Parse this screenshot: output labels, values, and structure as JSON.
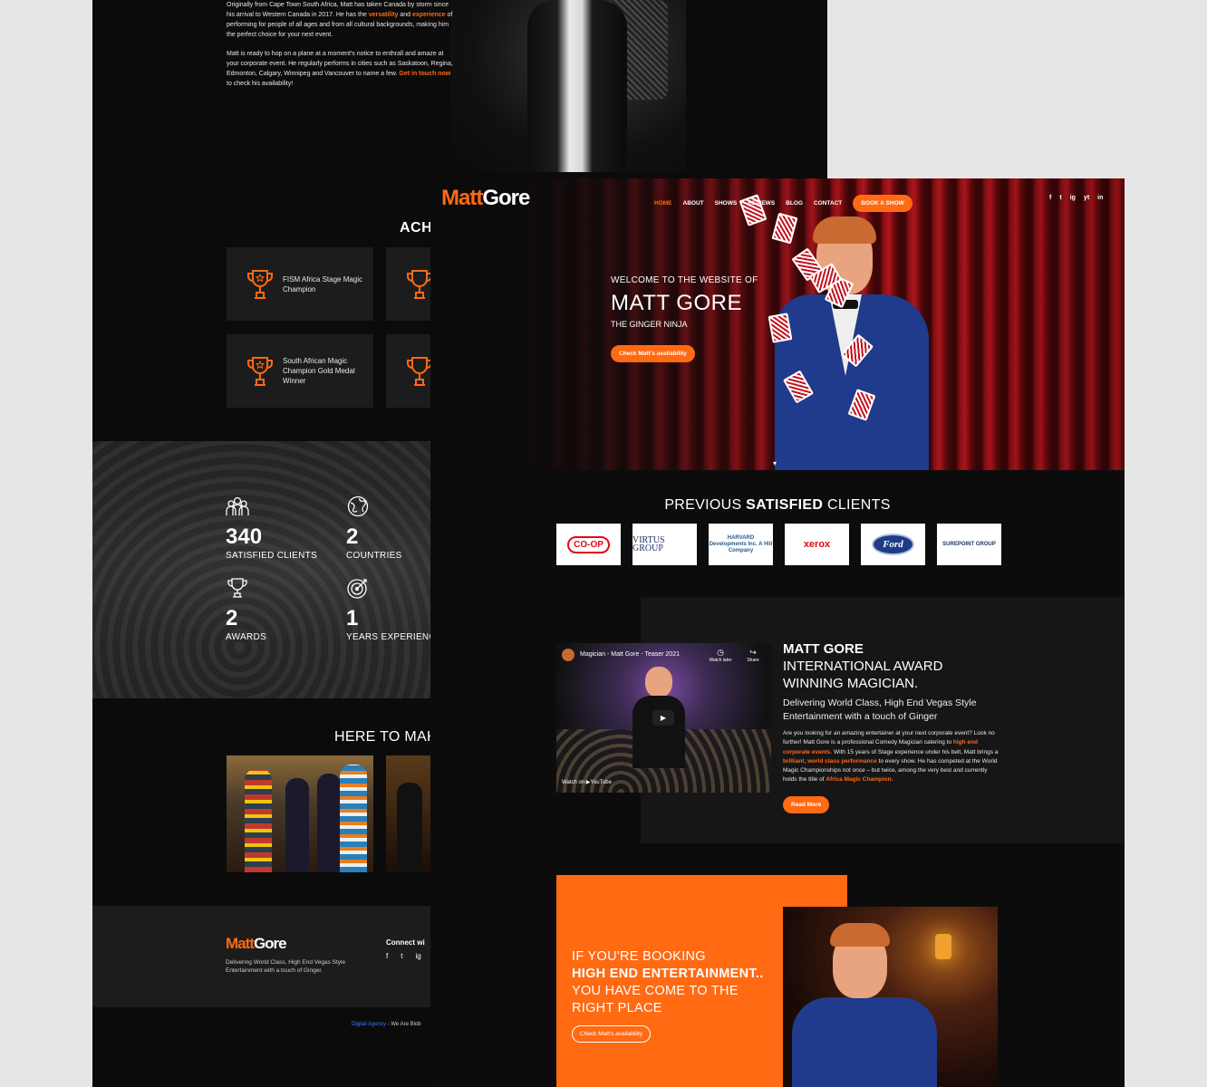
{
  "back": {
    "intro_p1_a": "Originally from Cape Town South Africa, Matt has taken Canada by storm since his arrival to Western Canada in 2017. He has the ",
    "intro_p1_hl1": "versatility",
    "intro_p1_b": " and ",
    "intro_p1_hl2": "experience",
    "intro_p1_c": " of performing for people of all ages and from all cultural backgrounds, making him the perfect choice for your next event.",
    "intro_p2_a": "Matt is ready to hop on a plane at a moment's notice to enthrall and amaze at your corporate event. He regularly performs in cities such as Saskatoon, Regina, Edmonton, Calgary, Winnipeg and Vancouver to name a few. ",
    "intro_p2_hl": "Get in touch now",
    "intro_p2_b": " to check his availability!",
    "achievements_title": "ACH",
    "achievements": [
      {
        "label": "FISM Africa Stage Magic Champion"
      },
      {
        "label": ""
      },
      {
        "label": "South African Magic Champion Gold Medal Winner"
      },
      {
        "label": ""
      }
    ],
    "stats": [
      {
        "num": "340",
        "label": "SATISFIED CLIENTS",
        "icon": "group-icon"
      },
      {
        "num": "2",
        "label": "COUNTRIES",
        "icon": "globe-icon"
      },
      {
        "num": "2",
        "label": "AWARDS",
        "icon": "trophy-icon"
      },
      {
        "num": "1",
        "label": "YEARS EXPERIENC",
        "icon": "target-icon"
      }
    ],
    "here_title": "HERE TO MAK",
    "footer": {
      "logo_a": "Matt",
      "logo_b": "Gore",
      "text": "Delivering World Class, High End Vegas Style Entertainment with a touch of Ginger.",
      "connect": "Connect wi",
      "socials": [
        "f",
        "t",
        "ig"
      ]
    },
    "credit_link": "Digital Agency",
    "credit_text": " - We Are Blob"
  },
  "front": {
    "logo_a": "Matt",
    "logo_b": "Gore",
    "nav": [
      "HOME",
      "ABOUT",
      "SHOWS",
      "REVIEWS",
      "BLOG",
      "CONTACT"
    ],
    "book_btn": "BOOK A SHOW",
    "socials": [
      "f",
      "t",
      "ig",
      "yt",
      "in"
    ],
    "hero": {
      "welcome": "WELCOME TO THE WEBSITE OF",
      "name": "MATT GORE",
      "tagline": "THE GINGER NINJA",
      "cta": "Check Matt's availability"
    },
    "clients_title_a": "PREVIOUS ",
    "clients_title_b": "SATISFIED",
    "clients_title_c": " CLIENTS",
    "clients": [
      "CO-OP",
      "VIRTUS GROUP",
      "HARVARD Developments Inc. A Hill Company",
      "xerox",
      "Ford",
      "SUREPOINT GROUP"
    ],
    "video": {
      "title": "Magician - Matt Gore - Teaser 2021",
      "watch_later": "Watch later",
      "share": "Share",
      "watch_on": "Watch on ▶YouTube"
    },
    "about": {
      "h1": "MATT GORE",
      "h2": "INTERNATIONAL AWARD WINNING MAGICIAN.",
      "sub": "Delivering World Class, High End Vegas Style Entertainment with a touch of Ginger",
      "body_a": "Are you looking for an amazing entertainer at your next corporate event? Look no further! Matt Gore is a professional Comedy Magician catering to ",
      "body_hl1": "high end corporate events",
      "body_b": ". With 15 years of Stage experience under his belt, Matt brings a ",
      "body_hl2": "brilliant",
      "body_c": ", ",
      "body_hl3": "world class performance",
      "body_d": " to every show. He has competed at the World Magic Championships not once – but twice, among the very best and currently holds the title of ",
      "body_hl4": "Africa Magic Champion",
      "body_e": ".",
      "btn": "Read More"
    },
    "booking": {
      "line1": "IF YOU'RE BOOKING",
      "line2": "HIGH END ENTERTAINMENT..",
      "line3": "YOU HAVE COME TO THE",
      "line4": "RIGHT PLACE",
      "btn": "Check Matt's availability"
    }
  },
  "colors": {
    "accent": "#ff6a13",
    "background": "#0c0c0c",
    "card": "#1c1c1c"
  }
}
